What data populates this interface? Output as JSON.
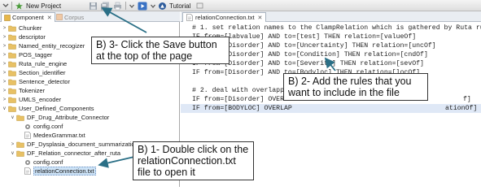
{
  "toolbar": {
    "new_project": "New Project",
    "tutorial": "Tutorial"
  },
  "left_panel": {
    "tabs": [
      {
        "label": "Component",
        "close": "✕"
      },
      {
        "label": "Corpus"
      }
    ],
    "tree": [
      {
        "label": "Chunker",
        "type": "folder",
        "state": "collapsed"
      },
      {
        "label": "descriptor",
        "type": "folder",
        "state": "collapsed"
      },
      {
        "label": "Named_entity_recogizer",
        "type": "folder",
        "state": "collapsed"
      },
      {
        "label": "POS_tagger",
        "type": "folder",
        "state": "collapsed"
      },
      {
        "label": "Ruta_rule_engine",
        "type": "folder",
        "state": "collapsed"
      },
      {
        "label": "Section_identifier",
        "type": "folder",
        "state": "collapsed"
      },
      {
        "label": "Sentence_detector",
        "type": "folder",
        "state": "collapsed"
      },
      {
        "label": "Tokenizer",
        "type": "folder",
        "state": "collapsed"
      },
      {
        "label": "UMLS_encoder",
        "type": "folder",
        "state": "collapsed"
      },
      {
        "label": "User_Defined_Components",
        "type": "folder",
        "state": "expanded"
      },
      {
        "label": "DF_Drug_Attribute_Connector",
        "type": "folder",
        "state": "expanded"
      },
      {
        "label": "config.conf",
        "type": "config"
      },
      {
        "label": "MedexGrammar.txt",
        "type": "file"
      },
      {
        "label": "DF_Dysplasia_document_summarization",
        "type": "folder",
        "state": "collapsed"
      },
      {
        "label": "DF_Relation_connector_after_ruta",
        "type": "folder",
        "state": "expanded"
      },
      {
        "label": "config.conf",
        "type": "config"
      },
      {
        "label": "relationConnection.txt",
        "type": "file",
        "selected": true
      }
    ]
  },
  "editor": {
    "tab_label": "relationConnection.txt",
    "tab_close": "✕",
    "lines": [
      "# 1. set relation names to the ClampRelation which is gathered by Ruta rules;",
      "IF from=[labvalue] AND to=[test] THEN relation=[valueOf]",
      "IF from=[Disorder] AND to=[Uncertainty] THEN relation=[uncOf]",
      "IF from=[Disorder] AND to=[Condition] THEN relation=[cndOf]",
      "IF from=[Disorder] AND to=[Severity] THEN relation=[sevOf]",
      "IF from=[Disorder] AND to=[Bodyloc] THEN relation=[locOf]",
      "",
      "# 2. deal with overlapped",
      "IF from=[Disorder] OVERLAP",
      "IF from=[BODYLOC] OVERLAP"
    ],
    "partial_tails": {
      "line8": "f]",
      "line9": "ationOf]"
    }
  },
  "callouts": {
    "save": [
      "B) 3- Click the Save button",
      "at the top of the page"
    ],
    "rules": [
      "B) 2- Add the rules that you",
      "want to include in the file"
    ],
    "open": [
      "B) 1- Double click on the",
      "relationConnection.txt",
      "file to open it"
    ]
  }
}
